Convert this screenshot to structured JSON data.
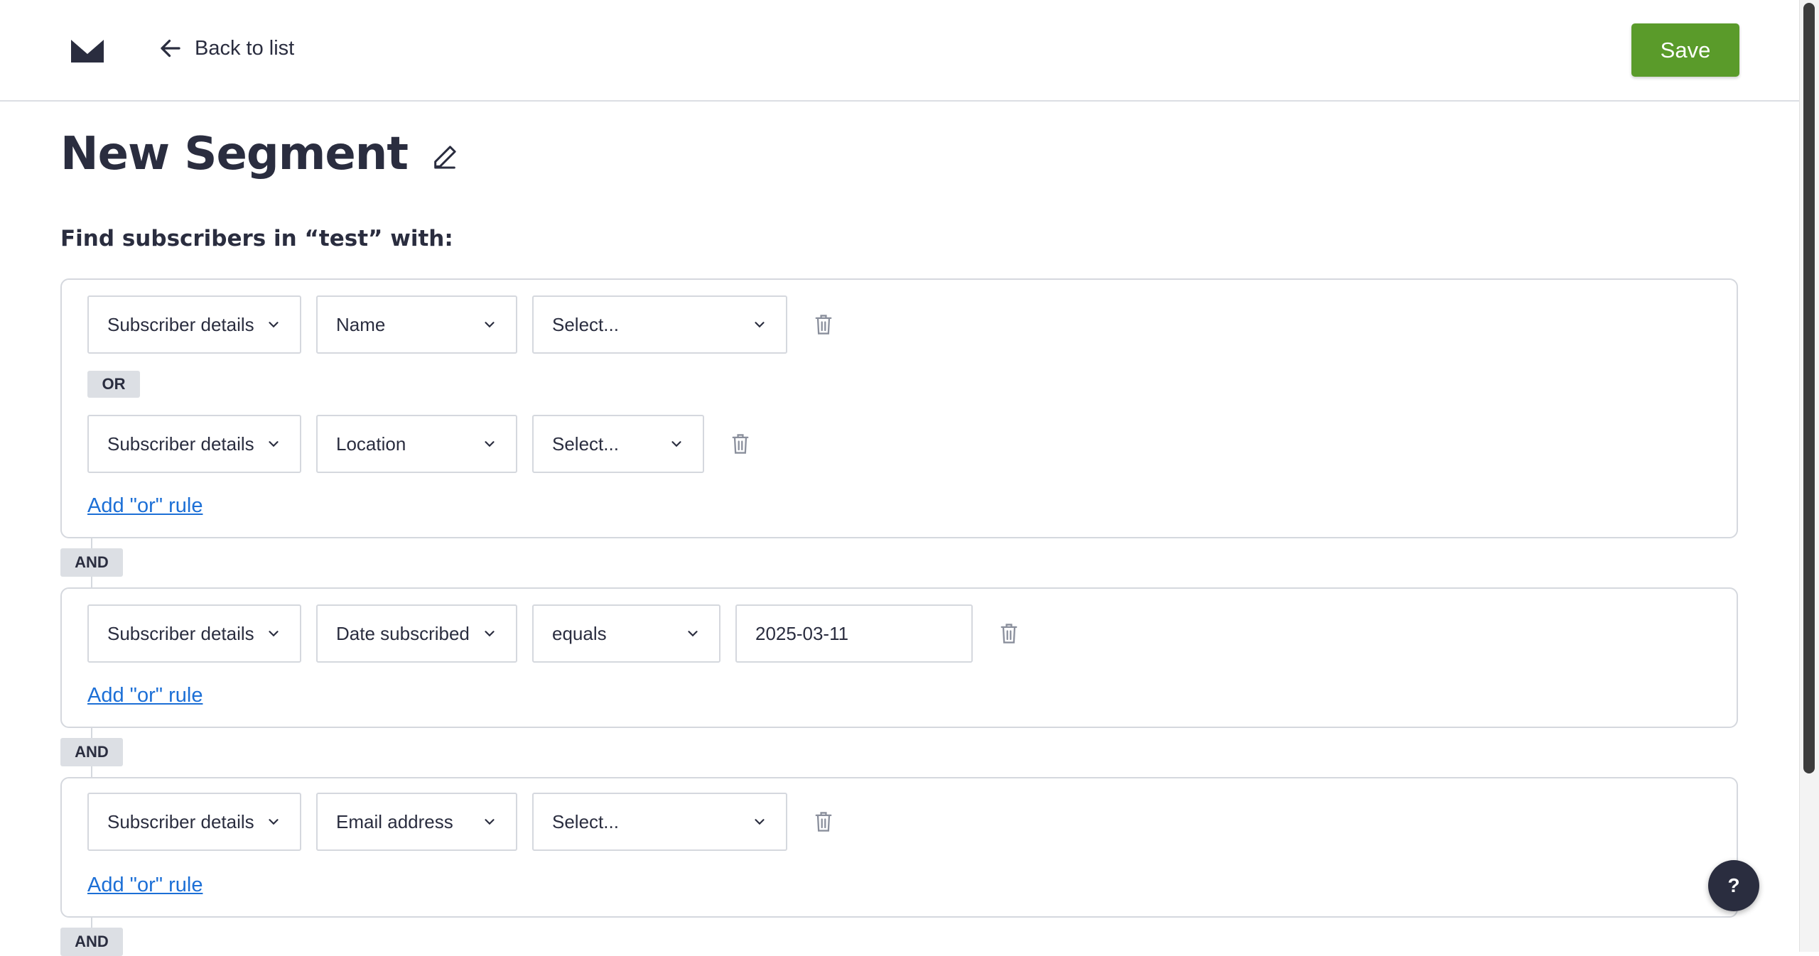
{
  "header": {
    "logo_icon": "envelope-logo-icon",
    "back_label": "Back to list",
    "save_label": "Save"
  },
  "page": {
    "title": "New Segment",
    "subtitle": "Find subscribers in “test” with:"
  },
  "groups": [
    {
      "rules": [
        {
          "category": "Subscriber details",
          "field": "Name",
          "operator": "Select..."
        },
        {
          "category": "Subscriber details",
          "field": "Location",
          "operator": "Select..."
        }
      ],
      "or_label": "OR",
      "add_or_label": "Add \"or\" rule"
    },
    {
      "rules": [
        {
          "category": "Subscriber details",
          "field": "Date subscribed",
          "operator": "equals",
          "value": "2025-03-11"
        }
      ],
      "add_or_label": "Add \"or\" rule"
    },
    {
      "rules": [
        {
          "category": "Subscriber details",
          "field": "Email address",
          "operator": "Select..."
        }
      ],
      "add_or_label": "Add \"or\" rule"
    }
  ],
  "and_label": "AND",
  "help_label": "?",
  "colors": {
    "accent": "#5a9b2a",
    "link": "#1c6fd6",
    "text": "#2a2d3f",
    "badge": "#dcdfe4"
  }
}
